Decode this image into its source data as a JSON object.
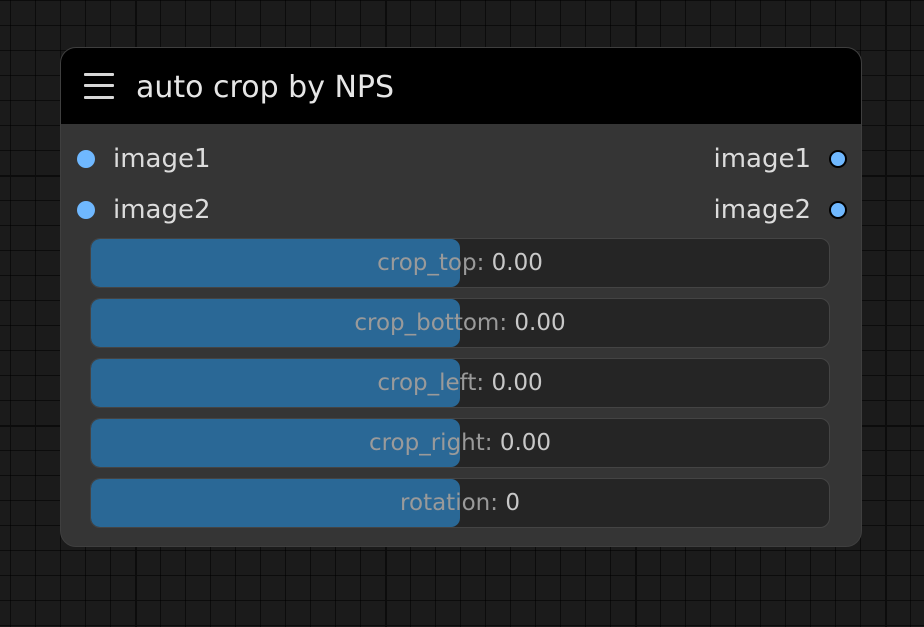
{
  "node": {
    "title": "auto crop by NPS",
    "menu_icon": "hamburger-menu-icon",
    "slot_color": "#6fb8ff",
    "inputs": [
      {
        "label": "image1"
      },
      {
        "label": "image2"
      }
    ],
    "outputs": [
      {
        "label": "image1"
      },
      {
        "label": "image2"
      }
    ],
    "widgets": [
      {
        "name": "crop_top",
        "value": "0.00",
        "fill_fraction": 0.5
      },
      {
        "name": "crop_bottom",
        "value": "0.00",
        "fill_fraction": 0.5
      },
      {
        "name": "crop_left",
        "value": "0.00",
        "fill_fraction": 0.5
      },
      {
        "name": "crop_right",
        "value": "0.00",
        "fill_fraction": 0.5
      },
      {
        "name": "rotation",
        "value": "0",
        "fill_fraction": 0.5
      }
    ]
  }
}
